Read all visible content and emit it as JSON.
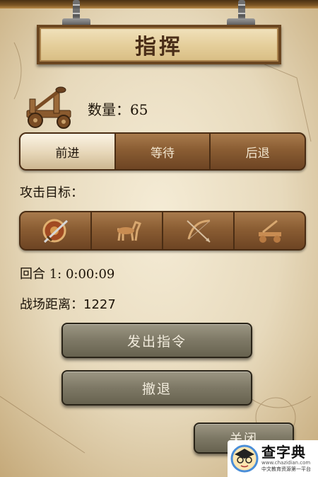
{
  "header": {
    "title": "指挥"
  },
  "unit": {
    "icon": "catapult-icon",
    "count_label": "数量：",
    "count_value": "65"
  },
  "stance": {
    "options": [
      "前进",
      "等待",
      "后退"
    ],
    "selected": "前进"
  },
  "targets": {
    "label": "攻击目标：",
    "options": [
      {
        "icon": "shield-sword-icon"
      },
      {
        "icon": "horse-icon"
      },
      {
        "icon": "bow-arrow-icon"
      },
      {
        "icon": "catapult-icon"
      }
    ]
  },
  "status": {
    "round": "回合 1: 0:00:09",
    "distance": "战场距离：1227"
  },
  "buttons": {
    "issue_order": "发出指令",
    "retreat": "撤退",
    "close": "关闭"
  },
  "watermark": {
    "title": "查字典",
    "url": "www.chazidian.com",
    "slogan": "中文教育资源第一平台"
  },
  "colors": {
    "panel_brown": "#8a5d33",
    "active_cream": "#f3e8d2",
    "button_gray": "#7d7865",
    "title_text": "#4a2e18"
  }
}
